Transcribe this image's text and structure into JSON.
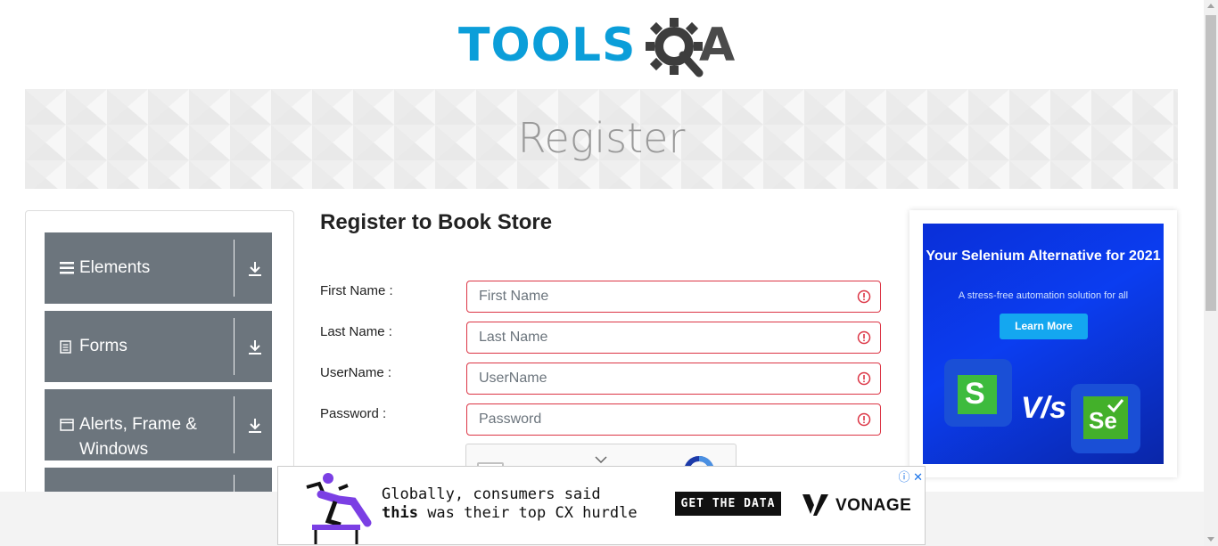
{
  "brand": {
    "logo_text_left": "TOOLS",
    "logo_text_right": "A",
    "logo_letter_q": "Q",
    "color_blue": "#0b9ed9",
    "color_gray": "#4a4a4a"
  },
  "header": {
    "banner_title": "Register"
  },
  "sidebar": {
    "groups": [
      {
        "label": "Elements",
        "icon": "hamburger-icon"
      },
      {
        "label": "Forms",
        "icon": "document-icon"
      },
      {
        "label": "Alerts, Frame & Windows",
        "icon": "window-icon"
      },
      {
        "label": "",
        "icon": ""
      }
    ]
  },
  "form": {
    "title": "Register to Book Store",
    "fields": [
      {
        "label": "First Name :",
        "placeholder": "First Name"
      },
      {
        "label": "Last Name :",
        "placeholder": "Last Name"
      },
      {
        "label": "UserName :",
        "placeholder": "UserName"
      },
      {
        "label": "Password :",
        "placeholder": "Password"
      }
    ],
    "error_color": "#dc3545"
  },
  "ad_right": {
    "headline": "Your Selenium Alternative for 2021",
    "subtext": "A stress-free automation solution for all",
    "cta": "Learn More",
    "vs_text": "V/s",
    "logo_left_letter": "S",
    "logo_right_letters": "Se"
  },
  "ad_bottom": {
    "line1": "Globally, consumers said",
    "line2_bold": "this",
    "line2_rest": " was their top CX hurdle",
    "cta": "GET THE DATA",
    "brand": "VONAGE",
    "close_glyph": "✕",
    "info_glyph": "ⓘ"
  }
}
